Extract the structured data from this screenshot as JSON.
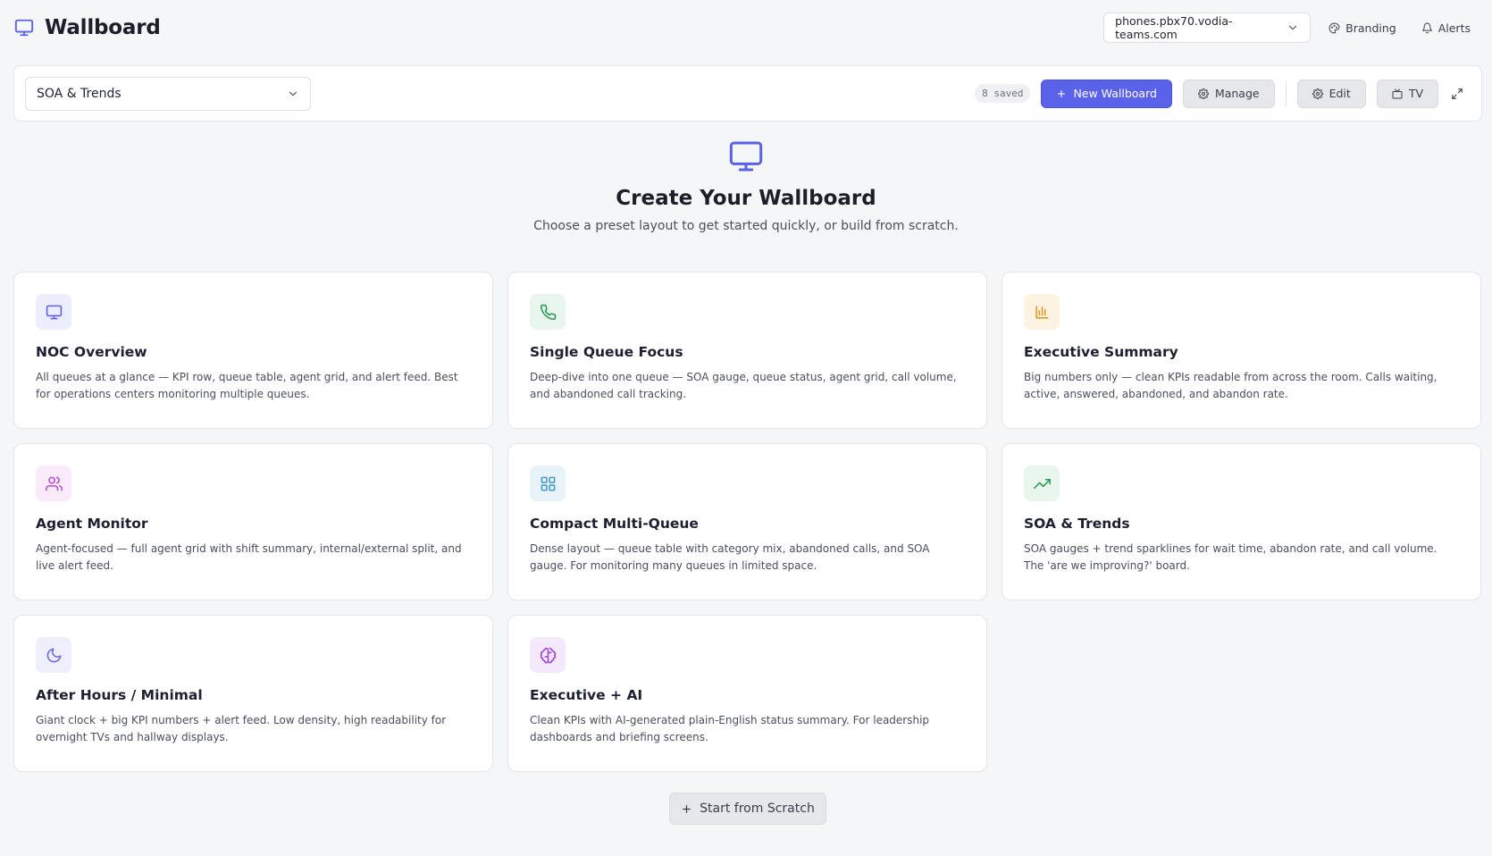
{
  "app": {
    "title": "Wallboard"
  },
  "header": {
    "server": "phones.pbx70.vodia-teams.com",
    "branding_label": "Branding",
    "alerts_label": "Alerts"
  },
  "toolbar": {
    "selected_wallboard": "SOA & Trends",
    "saved_count": "8 saved",
    "new_label": "New Wallboard",
    "manage_label": "Manage",
    "edit_label": "Edit",
    "tv_label": "TV"
  },
  "hero": {
    "title": "Create Your Wallboard",
    "subtitle": "Choose a preset layout to get started quickly, or build from scratch."
  },
  "presets": [
    {
      "title": "NOC Overview",
      "icon": "monitor-icon",
      "desc": "All queues at a glance — KPI row, queue table, agent grid, and alert feed. Best for operations centers monitoring multiple queues."
    },
    {
      "title": "Single Queue Focus",
      "icon": "phone-icon",
      "desc": "Deep-dive into one queue — SOA gauge, queue status, agent grid, call volume, and abandoned call tracking."
    },
    {
      "title": "Executive Summary",
      "icon": "bar-chart-icon",
      "desc": "Big numbers only — clean KPIs readable from across the room. Calls waiting, active, answered, abandoned, and abandon rate."
    },
    {
      "title": "Agent Monitor",
      "icon": "users-icon",
      "desc": "Agent-focused — full agent grid with shift summary, internal/external split, and live alert feed."
    },
    {
      "title": "Compact Multi-Queue",
      "icon": "grid-icon",
      "desc": "Dense layout — queue table with category mix, abandoned calls, and SOA gauge. For monitoring many queues in limited space."
    },
    {
      "title": "SOA & Trends",
      "icon": "trending-up-icon",
      "desc": "SOA gauges + trend sparklines for wait time, abandon rate, and call volume. The 'are we improving?' board."
    },
    {
      "title": "After Hours / Minimal",
      "icon": "moon-icon",
      "desc": "Giant clock + big KPI numbers + alert feed. Low density, high readability for overnight TVs and hallway displays."
    },
    {
      "title": "Executive + AI",
      "icon": "brain-icon",
      "desc": "Clean KPIs with AI-generated plain-English status summary. For leadership dashboards and briefing screens."
    }
  ],
  "scratch_label": "Start from Scratch",
  "colors": {
    "accent": "#5b62e6",
    "background": "#f5f6f8"
  }
}
